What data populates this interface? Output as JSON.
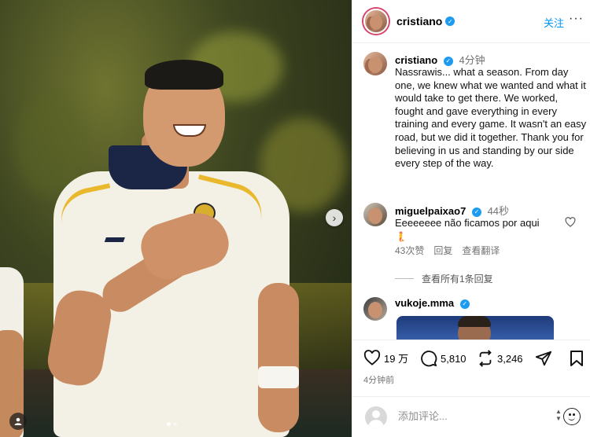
{
  "post": {
    "username": "cristiano",
    "follow_label": "关注",
    "more_label": "···",
    "caption": {
      "username": "cristiano",
      "time": "4分钟",
      "text": "Nassrawis... what a season. From day one, we knew what we wanted and what it would take to get there. We worked, fought and gave everything in every training and every game. It wasn't an easy road, but we did it together. Thank you for believing in us and standing by our side every step of the way."
    },
    "comments": [
      {
        "username": "miguelpaixao7",
        "time": "44秒",
        "text": "Eeeeeeee não ficamos por aqui",
        "emoji": "🧜",
        "likes": "43次赞",
        "reply_label": "回复",
        "translate_label": "查看翻译",
        "view_replies": "查看所有1条回复"
      },
      {
        "username": "vukoje.mma"
      }
    ],
    "actions": {
      "likes": "19 万",
      "comments": "5,810",
      "shares": "3,246"
    },
    "timestamp": "4分钟前",
    "comment_input_placeholder": "添加评论...",
    "carousel": {
      "current": 1,
      "total": 2
    }
  },
  "colors": {
    "link": "#0095f6",
    "verified": "#1d9bf0",
    "muted": "#737373"
  },
  "icons": [
    "verified-icon",
    "heart-icon",
    "comment-icon",
    "repost-icon",
    "share-icon",
    "chevron-right-icon",
    "emoji-icon",
    "tag-user-icon"
  ]
}
